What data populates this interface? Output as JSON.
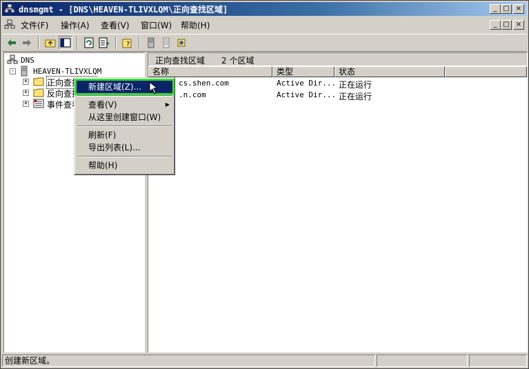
{
  "window": {
    "title": "dnsmgmt - [DNS\\HEAVEN-TLIVXLQM\\正向查找区域]",
    "minimize": "_",
    "maximize": "□",
    "close": "×"
  },
  "menubar": {
    "items": [
      "文件(F)",
      "操作(A)",
      "查看(V)",
      "窗口(W)",
      "帮助(H)"
    ]
  },
  "tree": {
    "root": "DNS",
    "server": "HEAVEN-TLIVXLQM",
    "children": [
      "正向查找区域",
      "反向查找区域",
      "事件查看器"
    ]
  },
  "right_pane": {
    "header_title": "正向查找区域",
    "header_count": "2 个区域",
    "columns": [
      "名称",
      "类型",
      "状态"
    ],
    "rows": [
      {
        "name": "cs.shen.com",
        "type": "Active Dir...",
        "status": "正在运行"
      },
      {
        "name": ".n.com",
        "type": "Active Dir...",
        "status": "正在运行"
      }
    ]
  },
  "context_menu": {
    "items": [
      "新建区域(Z)...",
      "查看(V)",
      "从这里创建窗口(W)",
      "刷新(F)",
      "导出列表(L)...",
      "帮助(H)"
    ],
    "submenu_arrow": "▶"
  },
  "status_bar": {
    "text": "创建新区域。"
  }
}
